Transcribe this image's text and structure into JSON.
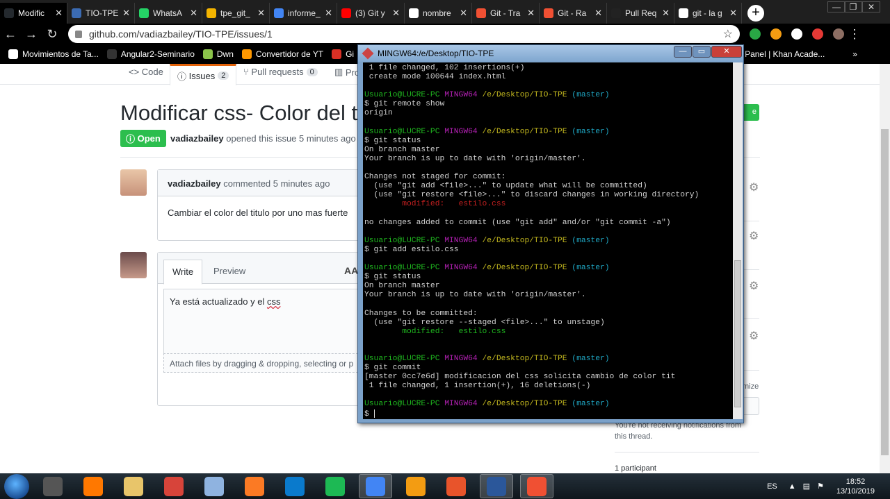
{
  "browser": {
    "tabs": [
      {
        "label": "Modific",
        "color": "#24292e",
        "active": true
      },
      {
        "label": "TIO-TPE",
        "color": "#3b6bb3"
      },
      {
        "label": "WhatsA",
        "color": "#25d366"
      },
      {
        "label": "tpe_git_",
        "color": "#f4b400"
      },
      {
        "label": "informe_",
        "color": "#4285f4"
      },
      {
        "label": "(3) Git y",
        "color": "#ff0000"
      },
      {
        "label": "nombre",
        "color": "#ffffff"
      },
      {
        "label": "Git - Tra",
        "color": "#f05033"
      },
      {
        "label": "Git - Ra",
        "color": "#f05033"
      },
      {
        "label": "Pull Req",
        "color": "#222222"
      },
      {
        "label": "git - la g",
        "color": "#ffffff"
      }
    ],
    "new_tab": "+",
    "url": "github.com/vadiazbailey/TIO-TPE/issues/1",
    "star": "☆",
    "bookmarks": [
      {
        "label": "Movimientos de Ta...",
        "color": "#ffffff"
      },
      {
        "label": "Angular2-Seminario",
        "color": "#333333"
      },
      {
        "label": "Dwn",
        "color": "#8bc34a"
      },
      {
        "label": "Convertidor de YT",
        "color": "#ff9800"
      },
      {
        "label": "Gi",
        "color": "#d93025"
      },
      {
        "label": "Panel | Khan Acade...",
        "color": "#14bf96"
      }
    ],
    "more_bookmarks": "»"
  },
  "github": {
    "tabs": {
      "code": "Code",
      "issues": "Issues",
      "issues_count": "2",
      "pulls": "Pull requests",
      "pulls_count": "0",
      "projects": "Pro"
    },
    "issue_title": "Modificar css- Color del tit",
    "new_issue_button": "e",
    "state": "Open",
    "author": "vadiazbailey",
    "opened_text": "opened this issue 5 minutes ago",
    "comment": {
      "author": "vadiazbailey",
      "meta": "commented 5 minutes ago",
      "body": "Cambiar el color del titulo por uno mas fuerte"
    },
    "editor": {
      "write_tab": "Write",
      "preview_tab": "Preview",
      "text_size": "AA",
      "text_before": "Ya está actualizado y  el ",
      "text_misspelled": "css",
      "attach_hint": "Attach files by dragging & dropping, selecting or p"
    },
    "sidebar": {
      "customize": "mize",
      "notif_text": "You're not receiving notifications from this thread.",
      "participants": "1 participant"
    }
  },
  "terminal": {
    "title": "MINGW64:/e/Desktop/TIO-TPE",
    "lines": [
      [
        {
          "t": " 1 file changed, 102 insertions(+)"
        }
      ],
      [
        {
          "t": " create mode 100644 index.html"
        }
      ],
      [
        {
          "t": ""
        }
      ],
      [
        {
          "t": "Usuario@LUCRE-PC ",
          "c": "g"
        },
        {
          "t": "MINGW64 ",
          "c": "m"
        },
        {
          "t": "/e/Desktop/TIO-TPE ",
          "c": "y"
        },
        {
          "t": "(master)",
          "c": "c"
        }
      ],
      [
        {
          "t": "$ git remote show"
        }
      ],
      [
        {
          "t": "origin"
        }
      ],
      [
        {
          "t": ""
        }
      ],
      [
        {
          "t": "Usuario@LUCRE-PC ",
          "c": "g"
        },
        {
          "t": "MINGW64 ",
          "c": "m"
        },
        {
          "t": "/e/Desktop/TIO-TPE ",
          "c": "y"
        },
        {
          "t": "(master)",
          "c": "c"
        }
      ],
      [
        {
          "t": "$ git status"
        }
      ],
      [
        {
          "t": "On branch master"
        }
      ],
      [
        {
          "t": "Your branch is up to date with 'origin/master'."
        }
      ],
      [
        {
          "t": ""
        }
      ],
      [
        {
          "t": "Changes not staged for commit:"
        }
      ],
      [
        {
          "t": "  (use \"git add <file>...\" to update what will be committed)"
        }
      ],
      [
        {
          "t": "  (use \"git restore <file>...\" to discard changes in working directory)"
        }
      ],
      [
        {
          "t": "        modified:   estilo.css",
          "c": "r"
        }
      ],
      [
        {
          "t": ""
        }
      ],
      [
        {
          "t": "no changes added to commit (use \"git add\" and/or \"git commit -a\")"
        }
      ],
      [
        {
          "t": ""
        }
      ],
      [
        {
          "t": "Usuario@LUCRE-PC ",
          "c": "g"
        },
        {
          "t": "MINGW64 ",
          "c": "m"
        },
        {
          "t": "/e/Desktop/TIO-TPE ",
          "c": "y"
        },
        {
          "t": "(master)",
          "c": "c"
        }
      ],
      [
        {
          "t": "$ git add estilo.css"
        }
      ],
      [
        {
          "t": ""
        }
      ],
      [
        {
          "t": "Usuario@LUCRE-PC ",
          "c": "g"
        },
        {
          "t": "MINGW64 ",
          "c": "m"
        },
        {
          "t": "/e/Desktop/TIO-TPE ",
          "c": "y"
        },
        {
          "t": "(master)",
          "c": "c"
        }
      ],
      [
        {
          "t": "$ git status"
        }
      ],
      [
        {
          "t": "On branch master"
        }
      ],
      [
        {
          "t": "Your branch is up to date with 'origin/master'."
        }
      ],
      [
        {
          "t": ""
        }
      ],
      [
        {
          "t": "Changes to be committed:"
        }
      ],
      [
        {
          "t": "  (use \"git restore --staged <file>...\" to unstage)"
        }
      ],
      [
        {
          "t": "        modified:   estilo.css",
          "c": "g"
        }
      ],
      [
        {
          "t": ""
        }
      ],
      [
        {
          "t": ""
        }
      ],
      [
        {
          "t": "Usuario@LUCRE-PC ",
          "c": "g"
        },
        {
          "t": "MINGW64 ",
          "c": "m"
        },
        {
          "t": "/e/Desktop/TIO-TPE ",
          "c": "y"
        },
        {
          "t": "(master)",
          "c": "c"
        }
      ],
      [
        {
          "t": "$ git commit"
        }
      ],
      [
        {
          "t": "[master 0cc7e6d] modificacion del css solicita cambio de color tit"
        }
      ],
      [
        {
          "t": " 1 file changed, 1 insertion(+), 16 deletions(-)"
        }
      ],
      [
        {
          "t": ""
        }
      ],
      [
        {
          "t": "Usuario@LUCRE-PC ",
          "c": "g"
        },
        {
          "t": "MINGW64 ",
          "c": "m"
        },
        {
          "t": "/e/Desktop/TIO-TPE ",
          "c": "y"
        },
        {
          "t": "(master)",
          "c": "c"
        }
      ],
      [
        {
          "t": "$ "
        }
      ]
    ]
  },
  "taskbar": {
    "apps": [
      {
        "name": "chrome-remote-icon",
        "color": "#555555"
      },
      {
        "name": "avast-icon",
        "color": "#ff7800"
      },
      {
        "name": "file-explorer-icon",
        "color": "#e8c56a"
      },
      {
        "name": "ccleaner-icon",
        "color": "#d7443a"
      },
      {
        "name": "app-icon",
        "color": "#8fb3e0"
      },
      {
        "name": "xampp-icon",
        "color": "#fb7a24"
      },
      {
        "name": "vscode-icon",
        "color": "#0a7acc"
      },
      {
        "name": "spotify-icon",
        "color": "#1db954"
      },
      {
        "name": "chrome-icon",
        "color": "#4285f4",
        "active": true
      },
      {
        "name": "settings-icon",
        "color": "#f39c12"
      },
      {
        "name": "app-icon",
        "color": "#e8542b"
      },
      {
        "name": "word-icon",
        "color": "#2b579a",
        "active": true
      },
      {
        "name": "git-icon",
        "color": "#f05033",
        "active": true
      }
    ],
    "language": "ES",
    "time": "18:52",
    "date": "13/10/2019"
  }
}
